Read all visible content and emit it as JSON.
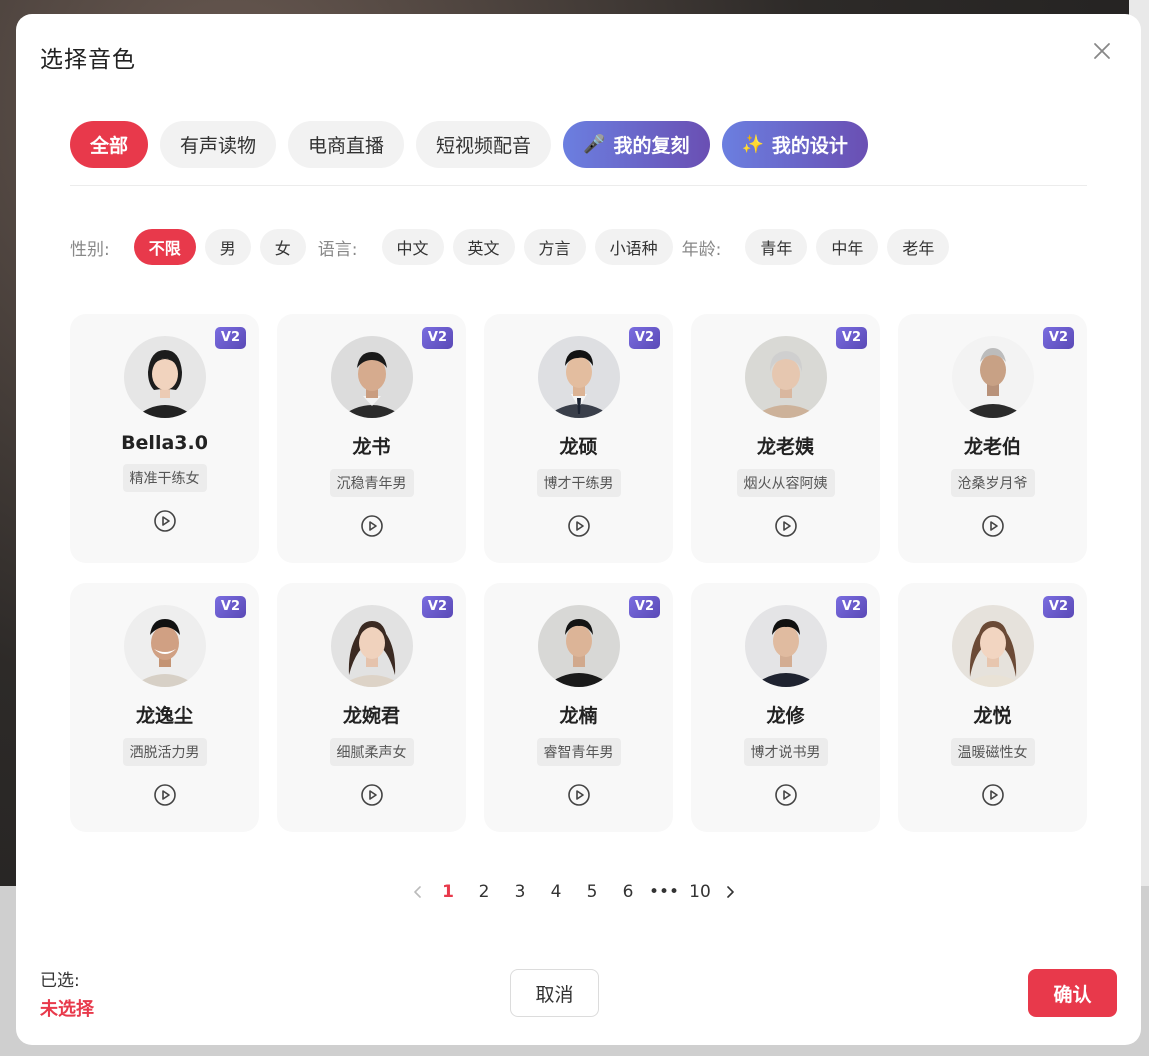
{
  "dialog": {
    "title": "选择音色"
  },
  "tabs": [
    {
      "label": "全部",
      "emoji": ""
    },
    {
      "label": "有声读物",
      "emoji": ""
    },
    {
      "label": "电商直播",
      "emoji": ""
    },
    {
      "label": "短视频配音",
      "emoji": ""
    },
    {
      "label": "我的复刻",
      "emoji": "🎤"
    },
    {
      "label": "我的设计",
      "emoji": "✨"
    }
  ],
  "filters": {
    "gender": {
      "label": "性别:",
      "options": [
        "不限",
        "男",
        "女"
      ]
    },
    "language": {
      "label": "语言:",
      "options": [
        "中文",
        "英文",
        "方言",
        "小语种"
      ]
    },
    "age": {
      "label": "年龄:",
      "options": [
        "青年",
        "中年",
        "老年"
      ]
    }
  },
  "voices": [
    {
      "name": "Bella3.0",
      "tag": "精准干练女",
      "badge": "V2"
    },
    {
      "name": "龙书",
      "tag": "沉稳青年男",
      "badge": "V2"
    },
    {
      "name": "龙硕",
      "tag": "博才干练男",
      "badge": "V2"
    },
    {
      "name": "龙老姨",
      "tag": "烟火从容阿姨",
      "badge": "V2"
    },
    {
      "name": "龙老伯",
      "tag": "沧桑岁月爷",
      "badge": "V2"
    },
    {
      "name": "龙逸尘",
      "tag": "洒脱活力男",
      "badge": "V2"
    },
    {
      "name": "龙婉君",
      "tag": "细腻柔声女",
      "badge": "V2"
    },
    {
      "name": "龙楠",
      "tag": "睿智青年男",
      "badge": "V2"
    },
    {
      "name": "龙修",
      "tag": "博才说书男",
      "badge": "V2"
    },
    {
      "name": "龙悦",
      "tag": "温暖磁性女",
      "badge": "V2"
    }
  ],
  "pagination": {
    "pages": [
      "1",
      "2",
      "3",
      "4",
      "5",
      "6",
      "•••",
      "10"
    ]
  },
  "footer": {
    "selected_label": "已选:",
    "selected_value": "未选择",
    "cancel_label": "取消",
    "confirm_label": "确认"
  },
  "colors": {
    "accent": "#e8394b",
    "badge": "#6a5ad0"
  }
}
